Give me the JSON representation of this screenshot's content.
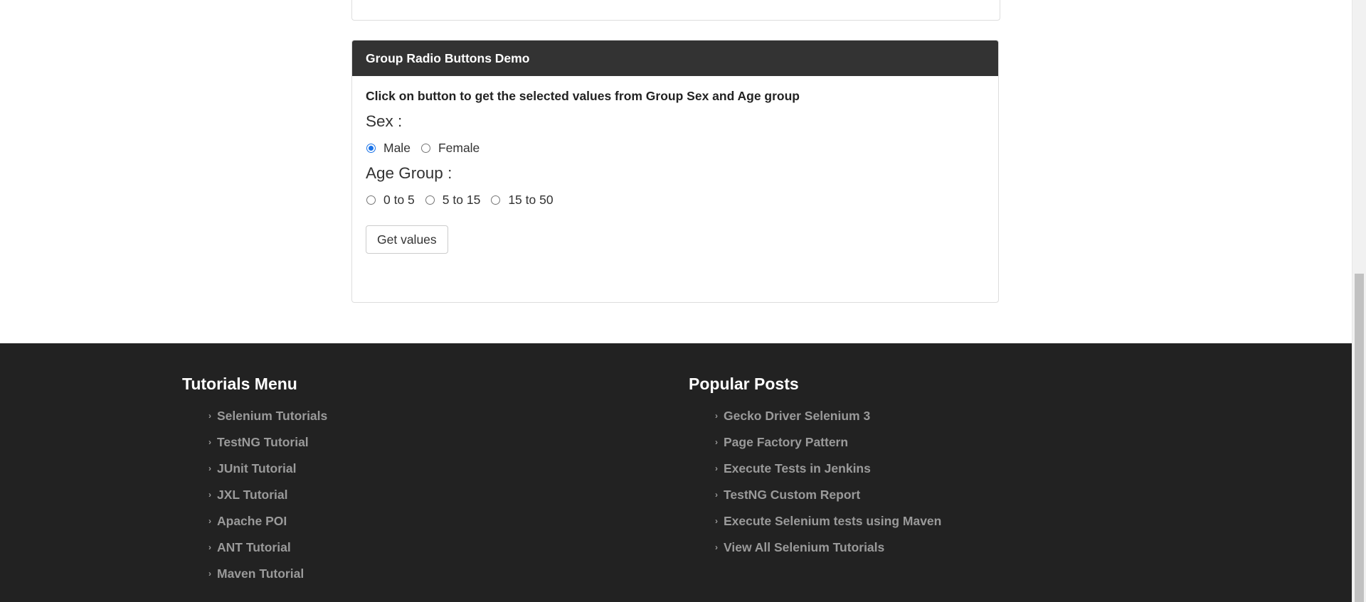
{
  "panel": {
    "heading": "Group Radio Buttons Demo",
    "instruction": "Click on button to get the selected values from Group Sex and Age group",
    "sex_label": "Sex :",
    "sex_options": [
      {
        "label": "Male",
        "checked": true
      },
      {
        "label": "Female",
        "checked": false
      }
    ],
    "age_label": "Age Group :",
    "age_options": [
      {
        "label": "0 to 5",
        "checked": false
      },
      {
        "label": "5 to 15",
        "checked": false
      },
      {
        "label": "15 to 50",
        "checked": false
      }
    ],
    "button_label": "Get values"
  },
  "footer": {
    "tutorials_title": "Tutorials Menu",
    "tutorials": [
      "Selenium Tutorials",
      "TestNG Tutorial",
      "JUnit Tutorial",
      "JXL Tutorial",
      "Apache POI",
      "ANT Tutorial",
      "Maven Tutorial"
    ],
    "posts_title": "Popular Posts",
    "posts": [
      "Gecko Driver Selenium 3",
      "Page Factory Pattern",
      "Execute Tests in Jenkins",
      "TestNG Custom Report",
      "Execute Selenium tests using Maven",
      "View All Selenium Tutorials"
    ]
  },
  "colors": {
    "heading_bg": "#333333",
    "footer_bg": "#222222",
    "link_gray": "#9a9a9a",
    "radio_accent": "#1a73e8"
  },
  "icons": {
    "list_bullet": "chevron-right-icon"
  }
}
